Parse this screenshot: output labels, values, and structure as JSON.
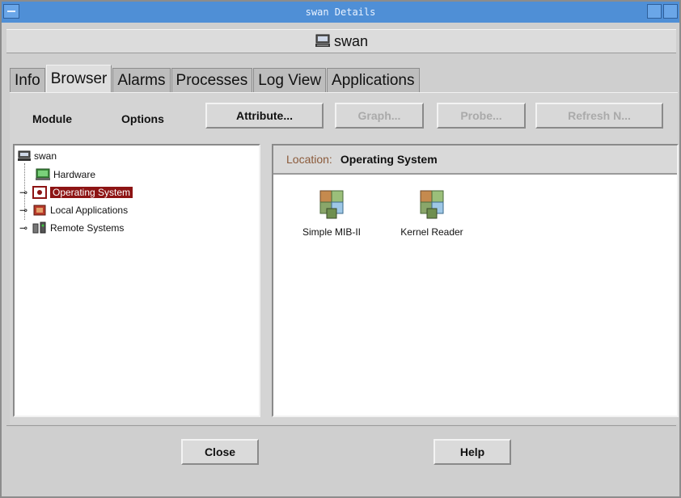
{
  "window": {
    "title": "swan Details",
    "host": "swan"
  },
  "tabs": [
    {
      "label": "Info"
    },
    {
      "label": "Browser"
    },
    {
      "label": "Alarms"
    },
    {
      "label": "Processes"
    },
    {
      "label": "Log View"
    },
    {
      "label": "Applications"
    }
  ],
  "active_tab": "Browser",
  "toolbar": {
    "module": "Module",
    "options": "Options",
    "attribute": "Attribute...",
    "graph": "Graph...",
    "probe": "Probe...",
    "refresh": "Refresh N..."
  },
  "tree": {
    "root": "swan",
    "items": [
      {
        "label": "Hardware"
      },
      {
        "label": "Operating System",
        "selected": true
      },
      {
        "label": "Local Applications"
      },
      {
        "label": "Remote Systems"
      }
    ]
  },
  "location": {
    "label": "Location:",
    "value": "Operating System"
  },
  "modules": [
    {
      "label": "Simple MIB-II",
      "icon": "cube-icon"
    },
    {
      "label": "Kernel Reader",
      "icon": "cube-icon"
    }
  ],
  "footer": {
    "close": "Close",
    "help": "Help"
  },
  "colors": {
    "titlebar": "#4f8fd6",
    "selection": "#8d1414",
    "panel": "#d4d4d4"
  }
}
